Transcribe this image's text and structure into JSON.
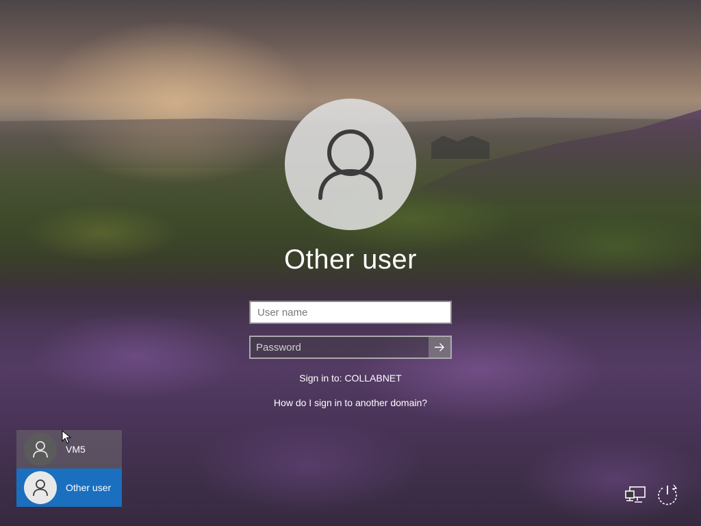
{
  "login": {
    "title": "Other user",
    "username_placeholder": "User name",
    "username_value": "",
    "password_placeholder": "Password",
    "password_value": "",
    "sign_in_to": "Sign in to: COLLABNET",
    "domain_help_link": "How do I sign in to another domain?"
  },
  "users": [
    {
      "name": "VM5",
      "selected": false
    },
    {
      "name": "Other user",
      "selected": true
    }
  ],
  "icons": {
    "submit": "arrow-right-icon",
    "avatar": "user-icon",
    "network": "network-icon",
    "power": "power-icon"
  },
  "colors": {
    "selected_tile": "#1a6fbf",
    "avatar_bg": "#dedede"
  }
}
